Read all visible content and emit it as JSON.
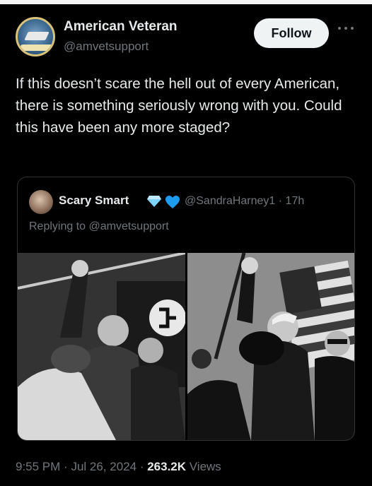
{
  "author": {
    "name": "American Veteran",
    "handle": "@amvetsupport",
    "follow_label": "Follow"
  },
  "tweet": {
    "text": "If this doesn’t scare the hell out of every American, there is something seriously wrong with you. Could this have been any more staged?"
  },
  "quote": {
    "name": "Scary Smart",
    "handle": "@SandraHarney1",
    "separator": "·",
    "time": "17h",
    "replying_to": "Replying to @amvetsupport",
    "badge_colors": {
      "diamond": "#7fd3ff",
      "heart": "#1d9bf0"
    }
  },
  "footer": {
    "time": "9:55 PM",
    "date": "Jul 26, 2024",
    "views_count": "263.2K",
    "views_label": "Views"
  },
  "colors": {
    "background": "#000000",
    "text": "#e7e9ea",
    "muted": "#71767b",
    "border": "#2f3336"
  }
}
